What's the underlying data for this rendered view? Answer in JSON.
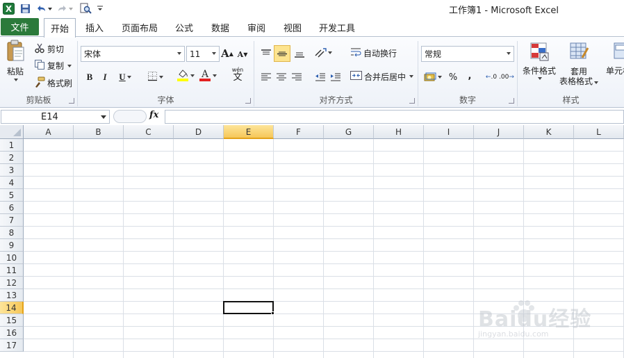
{
  "window": {
    "title": "工作簿1 - Microsoft Excel"
  },
  "quick_access": {
    "icons": [
      "excel-logo-icon",
      "save-icon",
      "undo-icon",
      "redo-icon",
      "print-preview-icon",
      "customize-qat-icon"
    ]
  },
  "tabs": {
    "file": "文件",
    "items": [
      "开始",
      "插入",
      "页面布局",
      "公式",
      "数据",
      "审阅",
      "视图",
      "开发工具"
    ],
    "active": "开始"
  },
  "ribbon": {
    "clipboard": {
      "label": "剪贴板",
      "paste": "粘贴",
      "cut": "剪切",
      "copy": "复制",
      "format_painter": "格式刷"
    },
    "font": {
      "label": "字体",
      "font_name": "宋体",
      "font_size": "11",
      "bold": "B",
      "italic": "I",
      "underline": "U",
      "grow": "A",
      "shrink": "A",
      "font_color_letter": "A",
      "wen": "wén"
    },
    "alignment": {
      "label": "对齐方式",
      "wrap_text": "自动换行",
      "merge_center": "合并后居中"
    },
    "number": {
      "label": "数字",
      "format": "常规",
      "percent": "%",
      "comma": ",",
      "inc_dec": ".00",
      "dec_dec": ".0"
    },
    "styles": {
      "label": "样式",
      "conditional": "条件格式",
      "table_format_line1": "套用",
      "table_format_line2": "表格格式",
      "cell_styles": "单元格"
    }
  },
  "formula_bar": {
    "name_box": "E14",
    "fx": "fx",
    "formula": ""
  },
  "grid": {
    "columns": [
      "A",
      "B",
      "C",
      "D",
      "E",
      "F",
      "G",
      "H",
      "I",
      "J",
      "K",
      "L"
    ],
    "rows": [
      "1",
      "2",
      "3",
      "4",
      "5",
      "6",
      "7",
      "8",
      "9",
      "10",
      "11",
      "12",
      "13",
      "14",
      "15",
      "16",
      "17"
    ],
    "selected_column": "E",
    "selected_row": "14",
    "active_cell": "E14"
  },
  "watermark": {
    "text": "Baidu经验",
    "sub": "jingyan.baidu.com"
  },
  "colors": {
    "file_tab": "#2b7a3b",
    "selected_header": "#f6c759",
    "grid_line": "#dadfe6",
    "ribbon_border": "#b6c1d0"
  }
}
